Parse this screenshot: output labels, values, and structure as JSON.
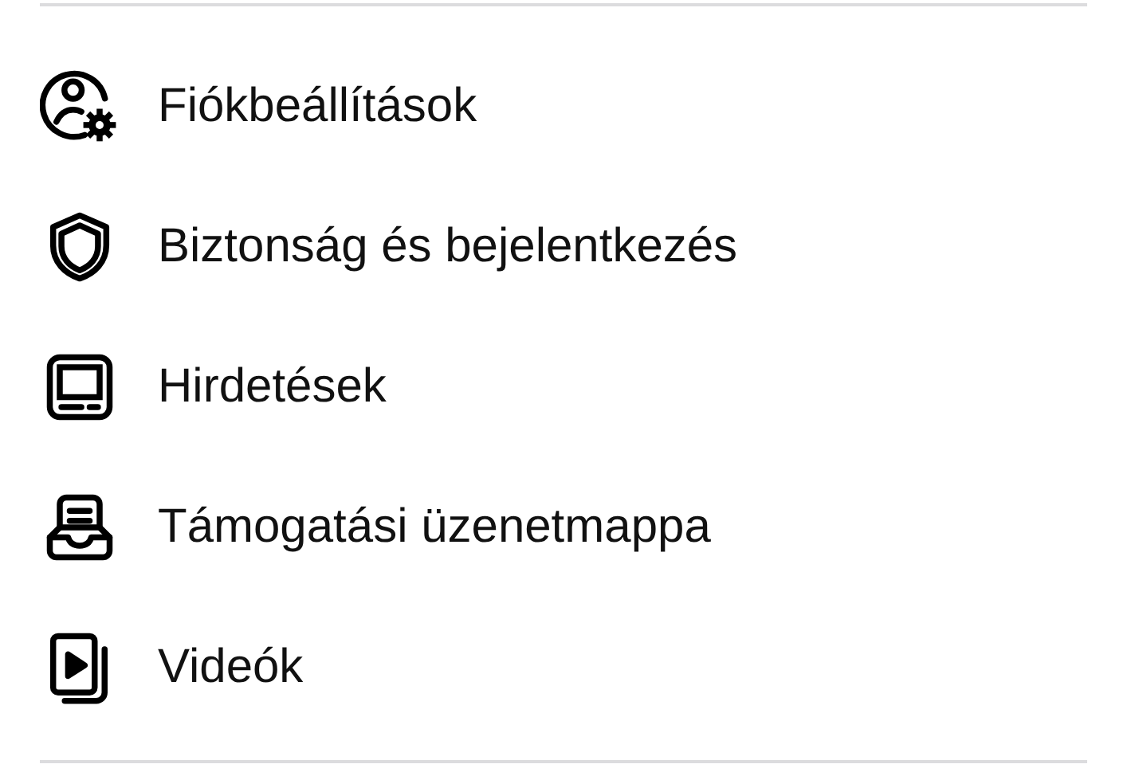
{
  "menu": {
    "items": [
      {
        "kind": "account-settings",
        "label": "Fiókbeállítások"
      },
      {
        "kind": "security",
        "label": "Biztonság és bejelentkezés"
      },
      {
        "kind": "ads",
        "label": "Hirdetések"
      },
      {
        "kind": "inbox",
        "label": "Támogatási üzenetmappa"
      },
      {
        "kind": "videos",
        "label": "Videók"
      }
    ]
  }
}
